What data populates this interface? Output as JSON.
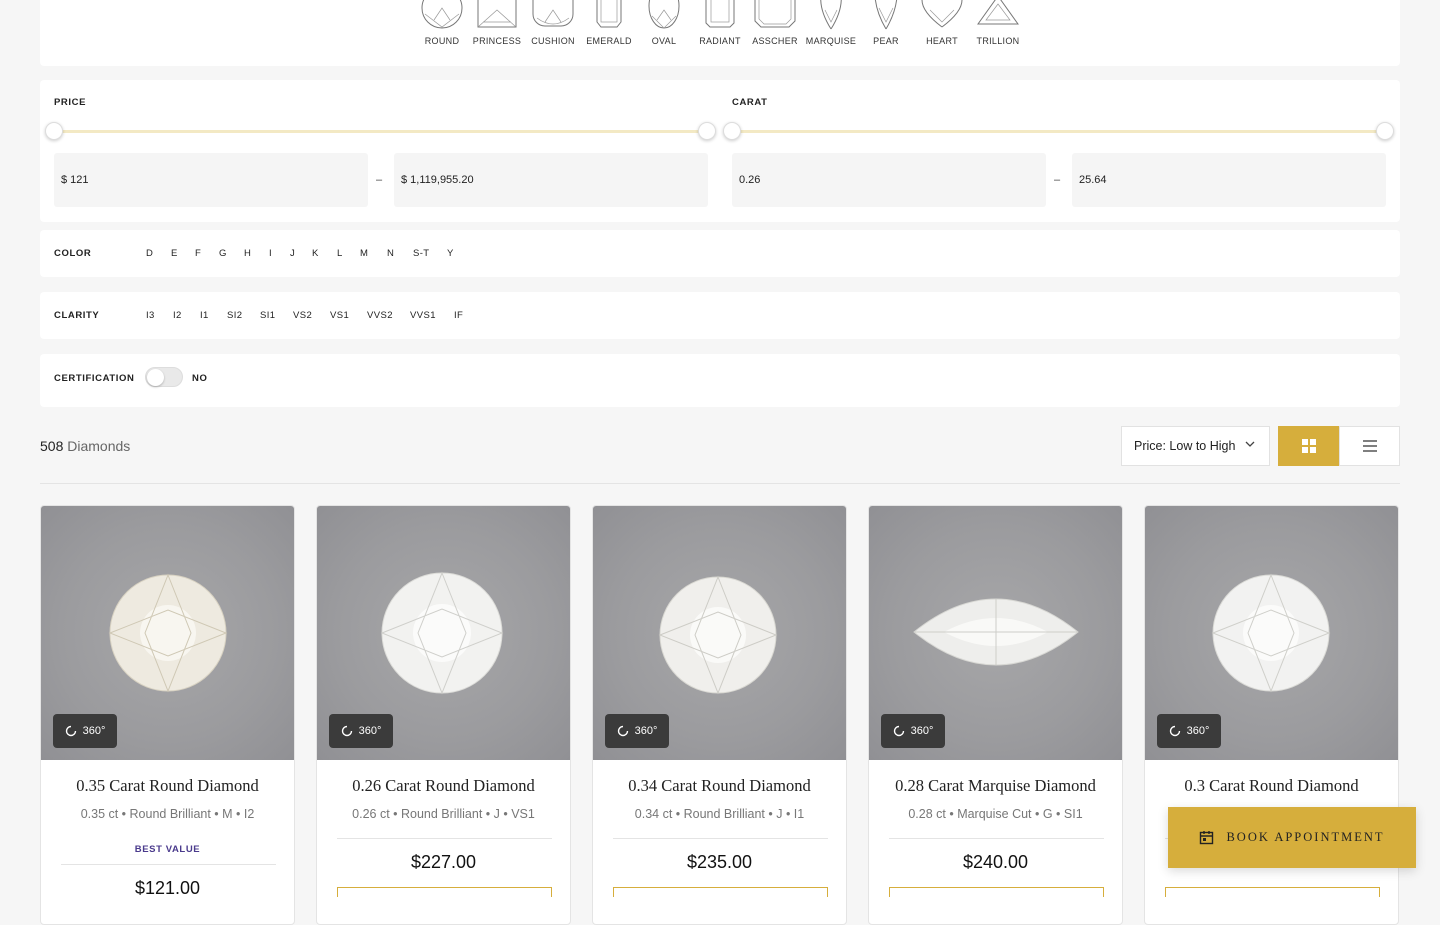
{
  "shapes": [
    {
      "label": "ROUND",
      "icon": "round-shape-icon"
    },
    {
      "label": "PRINCESS",
      "icon": "princess-shape-icon"
    },
    {
      "label": "CUSHION",
      "icon": "cushion-shape-icon"
    },
    {
      "label": "EMERALD",
      "icon": "emerald-shape-icon"
    },
    {
      "label": "OVAL",
      "icon": "oval-shape-icon"
    },
    {
      "label": "RADIANT",
      "icon": "radiant-shape-icon"
    },
    {
      "label": "ASSCHER",
      "icon": "asscher-shape-icon"
    },
    {
      "label": "MARQUISE",
      "icon": "marquise-shape-icon"
    },
    {
      "label": "PEAR",
      "icon": "pear-shape-icon"
    },
    {
      "label": "HEART",
      "icon": "heart-shape-icon"
    },
    {
      "label": "TRILLION",
      "icon": "trillion-shape-icon"
    }
  ],
  "filters": {
    "price": {
      "label": "PRICE",
      "min": "$ 121",
      "max": "$ 1,119,955.20",
      "separator": "–"
    },
    "carat": {
      "label": "CARAT",
      "min": "0.26",
      "max": "25.64",
      "separator": "–"
    },
    "color": {
      "label": "COLOR",
      "options": [
        "D",
        "E",
        "F",
        "G",
        "H",
        "I",
        "J",
        "K",
        "L",
        "M",
        "N",
        "S-T",
        "Y"
      ]
    },
    "clarity": {
      "label": "CLARITY",
      "options": [
        "I3",
        "I2",
        "I1",
        "SI2",
        "SI1",
        "VS2",
        "VS1",
        "VVS2",
        "VVS1",
        "IF"
      ]
    },
    "certification": {
      "label": "CERTIFICATION",
      "value": "NO"
    }
  },
  "results": {
    "count": "508",
    "count_label": "Diamonds"
  },
  "sort": {
    "selected": "Price: Low to High"
  },
  "colors": {
    "accent": "#d6ae3c",
    "best_value": "#4a3a8c"
  },
  "products": [
    {
      "title": "0.35 Carat Round Diamond",
      "sub": "0.35 ct • Round Brilliant • M • I2",
      "badge": "BEST VALUE",
      "price": "$121.00",
      "view": "360°",
      "shape": "round"
    },
    {
      "title": "0.26 Carat Round Diamond",
      "sub": "0.26 ct • Round Brilliant • J • VS1",
      "badge": "",
      "price": "$227.00",
      "view": "360°",
      "shape": "round"
    },
    {
      "title": "0.34 Carat Round Diamond",
      "sub": "0.34 ct • Round Brilliant • J • I1",
      "badge": "",
      "price": "$235.00",
      "view": "360°",
      "shape": "round"
    },
    {
      "title": "0.28 Carat Marquise Diamond",
      "sub": "0.28 ct • Marquise Cut • G • SI1",
      "badge": "",
      "price": "$240.00",
      "view": "360°",
      "shape": "marquise"
    },
    {
      "title": "0.3 Carat Round Diamond",
      "sub": "",
      "badge": "",
      "price": "",
      "view": "360°",
      "shape": "round"
    }
  ],
  "cta": {
    "book_label": "BOOK APPOINTMENT"
  }
}
